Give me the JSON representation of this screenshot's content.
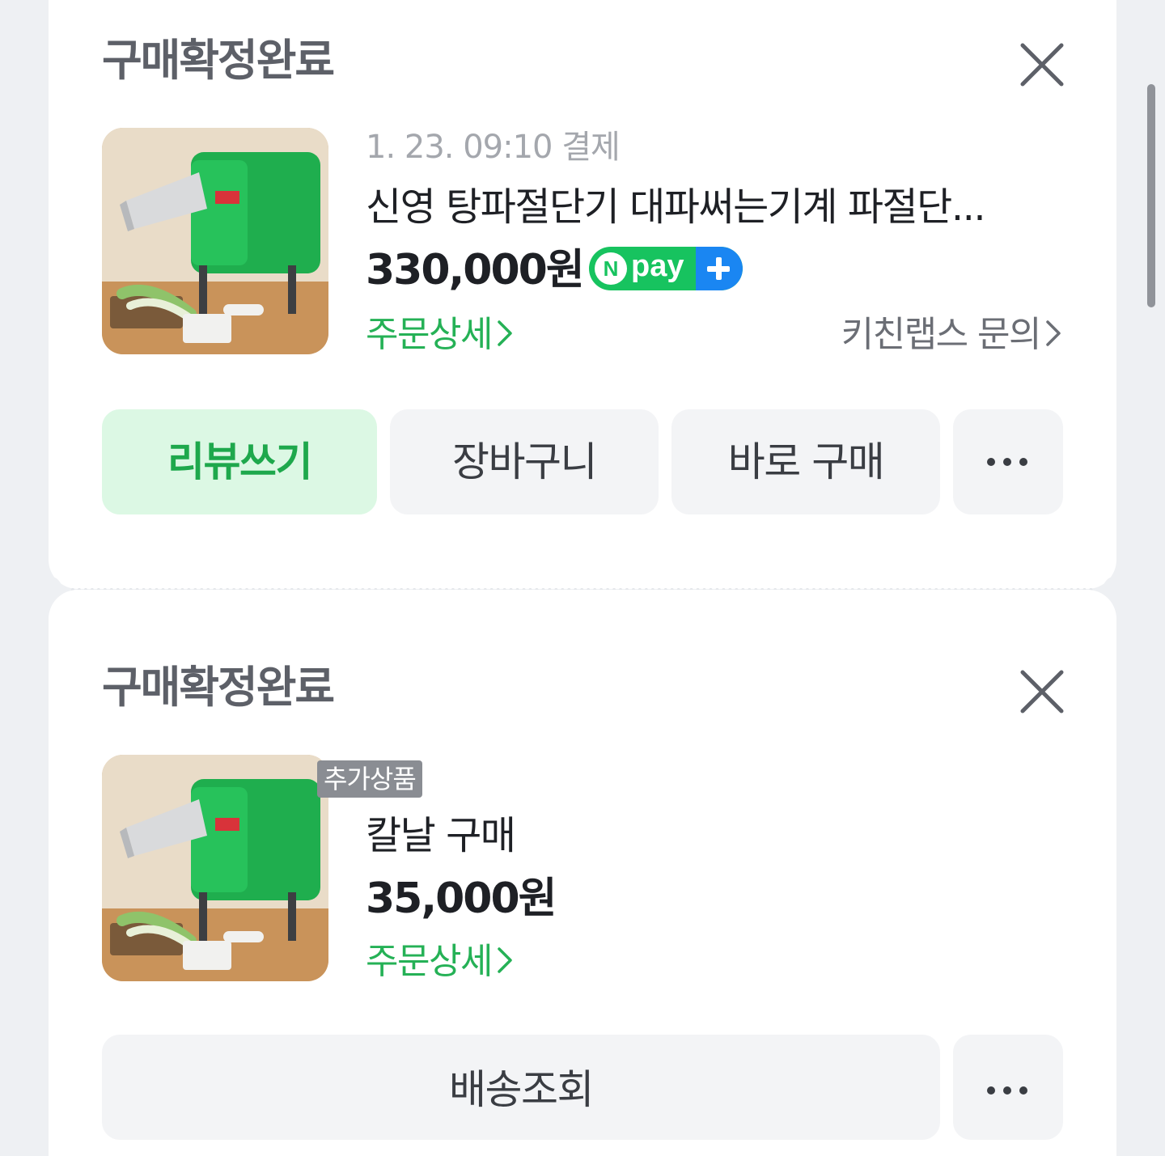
{
  "orders": [
    {
      "status": "구매확정완료",
      "payment_date": "1. 23. 09:10 결제",
      "product_name": "신영 탕파절단기 대파써는기계 파절단...",
      "price": "330,000원",
      "npay_badge": "pay",
      "order_detail_link": "주문상세",
      "seller_inquiry_link": "키친랩스 문의",
      "buttons": [
        "리뷰쓰기",
        "장바구니",
        "바로 구매"
      ],
      "more_icon": "more-dots-icon",
      "close_icon": "close-icon"
    },
    {
      "status": "구매확정완료",
      "tag": "추가상품",
      "product_name": "칼날 구매",
      "price": "35,000원",
      "order_detail_link": "주문상세",
      "buttons": [
        "배송조회"
      ],
      "more_icon": "more-dots-icon",
      "close_icon": "close-icon"
    }
  ],
  "colors": {
    "accent_green": "#25b156",
    "review_button_bg": "#dcf8e4",
    "npay_green": "#17c35f",
    "npay_blue": "#1a86f2"
  }
}
